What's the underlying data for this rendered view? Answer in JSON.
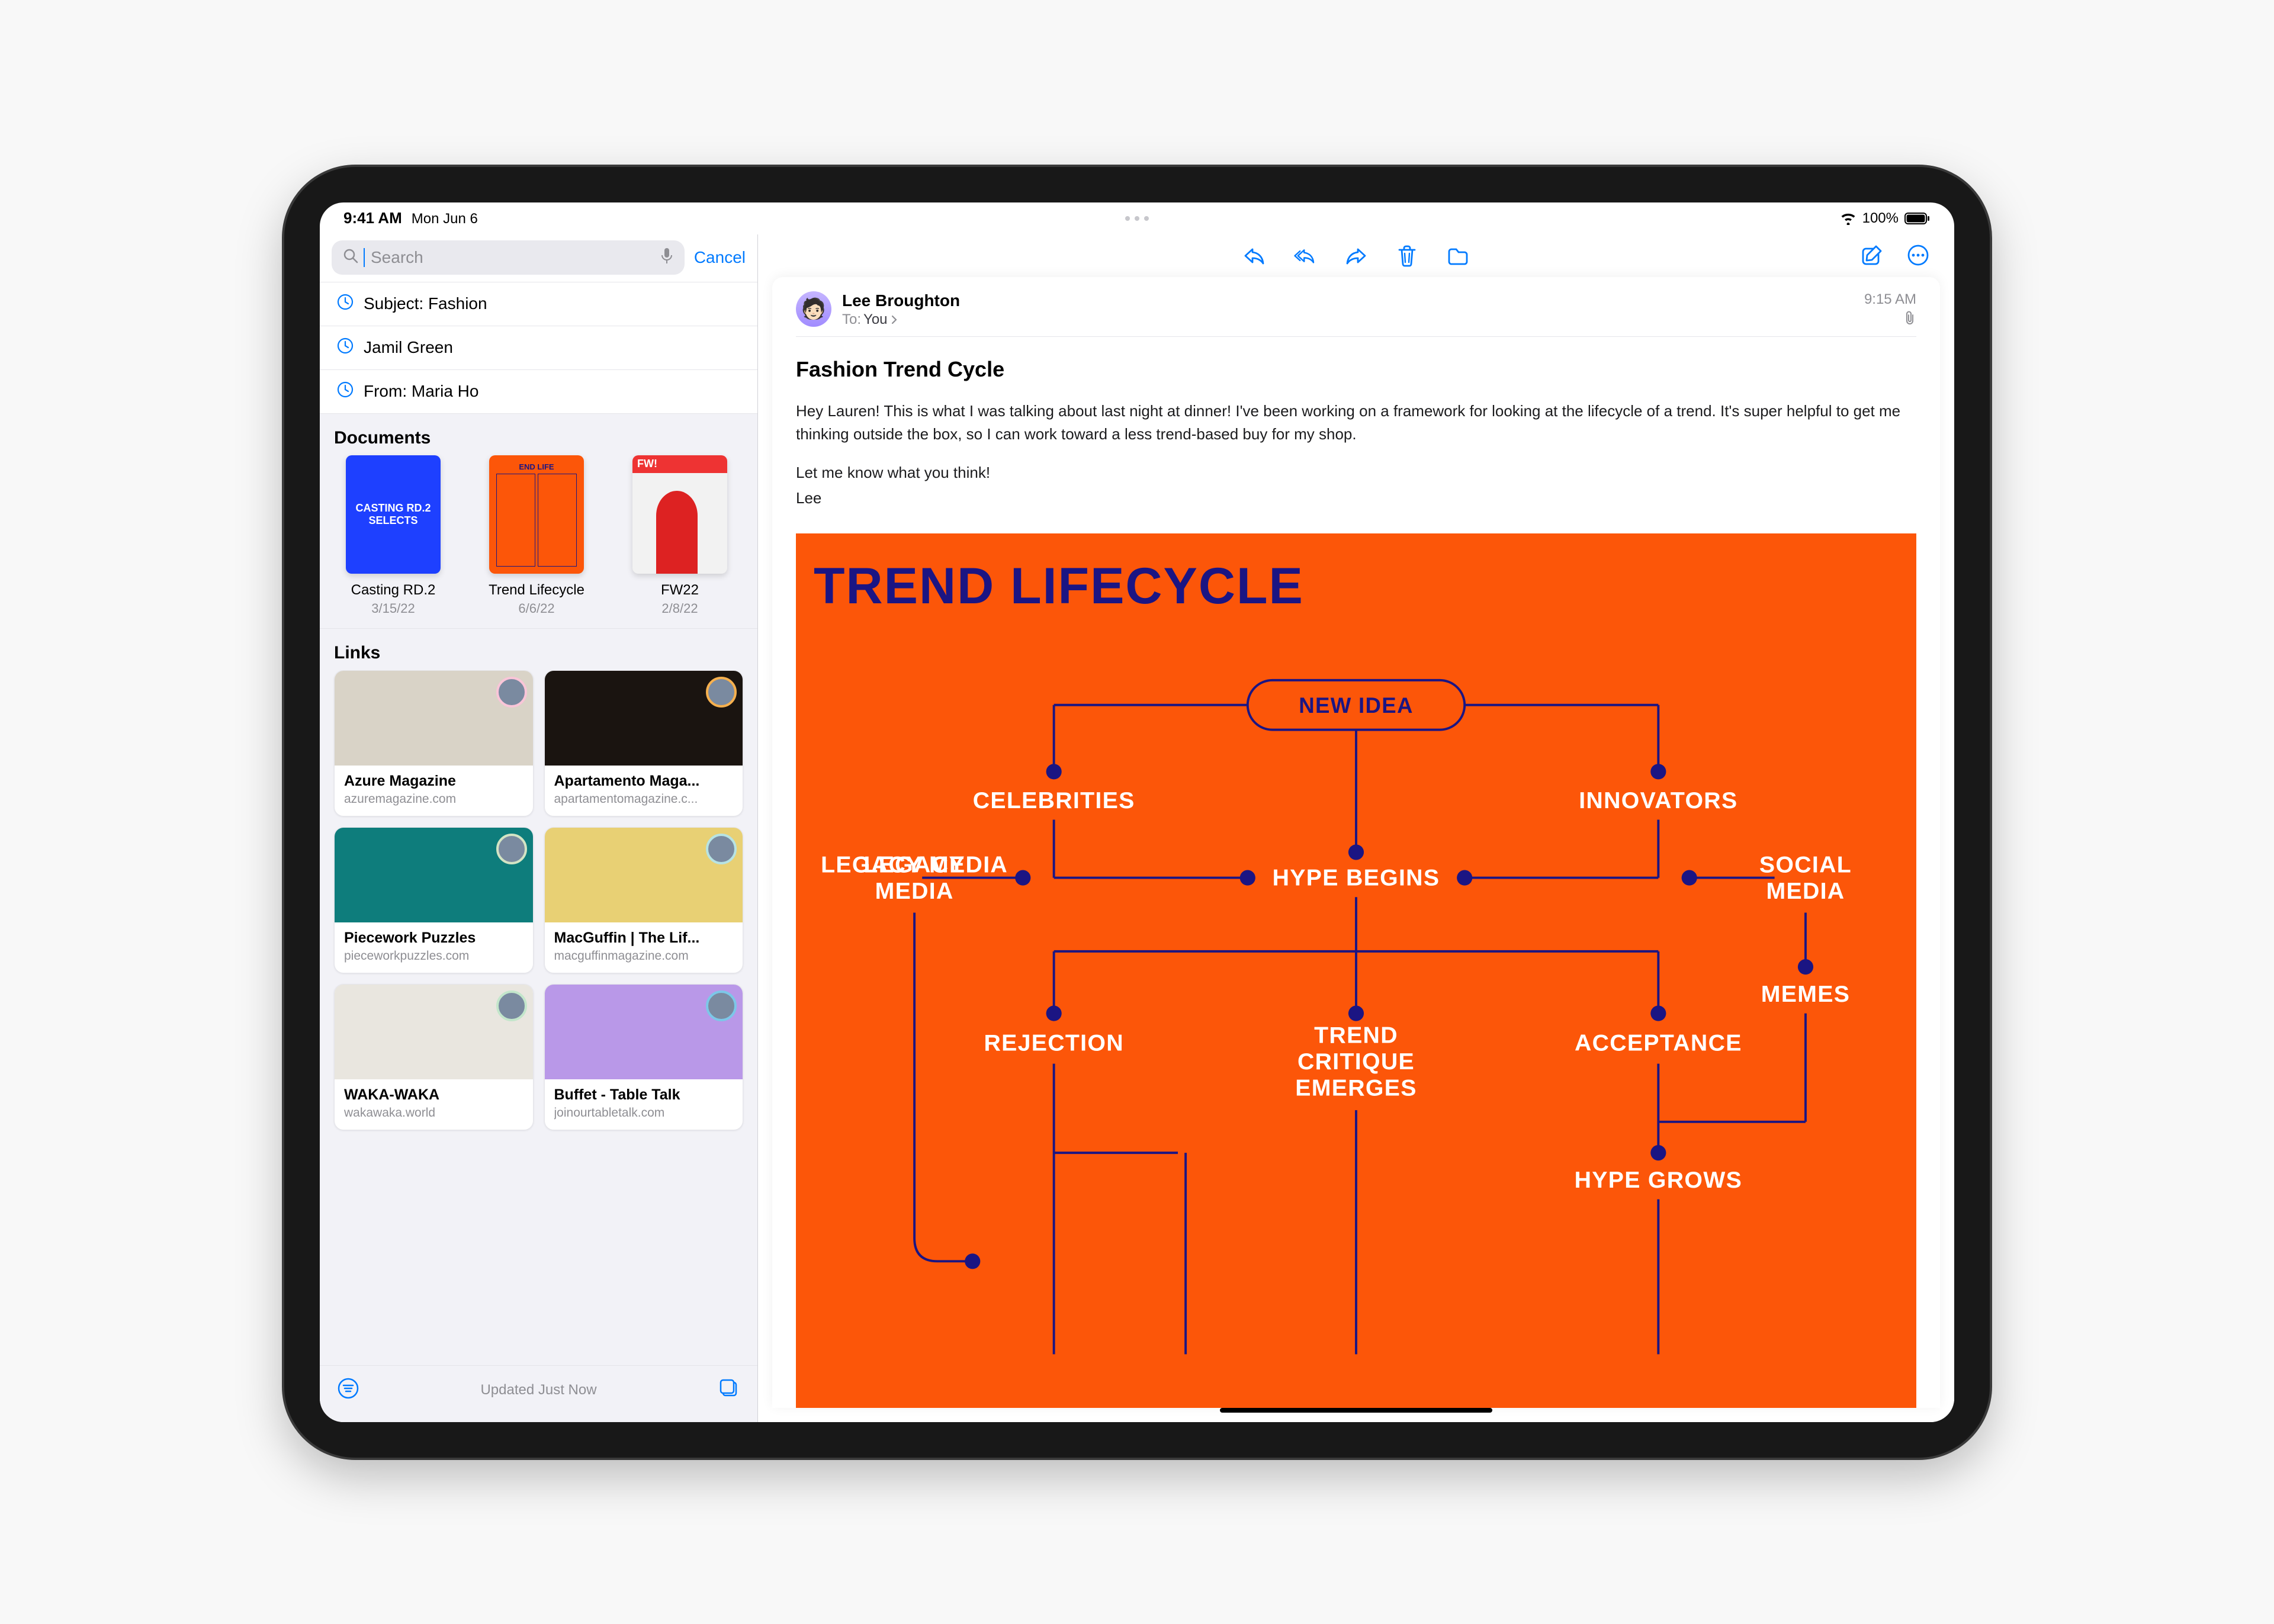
{
  "status": {
    "time": "9:41 AM",
    "date": "Mon Jun 6",
    "battery": "100%"
  },
  "search": {
    "placeholder": "Search",
    "cancel": "Cancel"
  },
  "recent": [
    {
      "text": "Subject: Fashion"
    },
    {
      "text": "Jamil Green"
    },
    {
      "text": "From: Maria Ho"
    }
  ],
  "documents": {
    "heading": "Documents",
    "items": [
      {
        "title": "Casting RD.2",
        "date": "3/15/22",
        "thumb_text": "CASTING RD.2 SELECTS",
        "style": "blue"
      },
      {
        "title": "Trend Lifecycle",
        "date": "6/6/22",
        "thumb_text": "END LIFE",
        "style": "orange"
      },
      {
        "title": "FW22",
        "date": "2/8/22",
        "thumb_text": "FW!",
        "style": "white"
      }
    ]
  },
  "links": {
    "heading": "Links",
    "items": [
      {
        "title": "Azure Magazine",
        "url": "azuremagazine.com",
        "avatar_border": "#f9c5d8",
        "thumb": "#d9d3c7"
      },
      {
        "title": "Apartamento Maga...",
        "url": "apartamentomagazine.c...",
        "avatar_border": "#f6b04e",
        "thumb": "#1a1410"
      },
      {
        "title": "Piecework Puzzles",
        "url": "pieceworkpuzzles.com",
        "avatar_border": "#d3e4c4",
        "thumb": "#0e7d7c"
      },
      {
        "title": "MacGuffin | The Lif...",
        "url": "macguffinmagazine.com",
        "avatar_border": "#b7e3e3",
        "thumb": "#e8d074"
      },
      {
        "title": "WAKA-WAKA",
        "url": "wakawaka.world",
        "avatar_border": "#c3e6cb",
        "thumb": "#e9e6df"
      },
      {
        "title": "Buffet - Table Talk",
        "url": "joinourtabletalk.com",
        "avatar_border": "#7cc7e8",
        "thumb": "#b998e8"
      }
    ]
  },
  "status_line": "Updated Just Now",
  "message": {
    "sender": "Lee Broughton",
    "to_label": "To:",
    "to_value": "You",
    "time": "9:15 AM",
    "subject": "Fashion Trend Cycle",
    "body": [
      "Hey Lauren! This is what I was talking about last night at dinner! I've been working on a framework for looking at the lifecycle of a trend. It's super helpful to get me thinking outside the box, so I can work toward a less trend-based buy for my shop.",
      "Let me know what you think!",
      "Lee"
    ]
  },
  "infographic": {
    "title": "TREND LIFECYCLE",
    "root": "NEW IDEA",
    "nodes": {
      "celebrities": "CELEBRITIES",
      "innovators": "INNOVATORS",
      "hype_begins": "HYPE BEGINS",
      "legacy_media": "LEGACY MEDIA",
      "social_media": "SOCIAL MEDIA",
      "memes": "MEMES",
      "rejection": "REJECTION",
      "trend_critique": "TREND CRITIQUE EMERGES",
      "acceptance": "ACCEPTANCE",
      "hype_grows": "HYPE GROWS"
    }
  }
}
